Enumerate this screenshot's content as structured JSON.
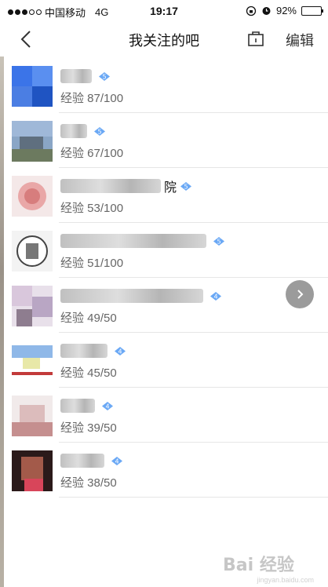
{
  "status_bar": {
    "carrier": "中国移动",
    "network": "4G",
    "time": "19:17",
    "battery": "92%",
    "battery_level": 0.92
  },
  "header": {
    "title": "我关注的吧",
    "edit_label": "编辑"
  },
  "bars": [
    {
      "name_suffix": "",
      "level": "5",
      "exp": "经验 87/100"
    },
    {
      "name_suffix": "",
      "level": "5",
      "exp": "经验 67/100"
    },
    {
      "name_suffix": "院",
      "level": "5",
      "exp": "经验 53/100"
    },
    {
      "name_suffix": "",
      "level": "5",
      "exp": "经验 51/100"
    },
    {
      "name_suffix": "",
      "level": "4",
      "exp": "经验 49/50"
    },
    {
      "name_suffix": "",
      "level": "4",
      "exp": "经验 45/50"
    },
    {
      "name_suffix": "",
      "level": "4",
      "exp": "经验 39/50"
    },
    {
      "name_suffix": "",
      "level": "4",
      "exp": "经验 38/50"
    }
  ],
  "watermark": {
    "main": "Bai 经验",
    "sub": "jingyan.baidu.com"
  },
  "icons": {
    "back": "chevron-left-icon",
    "bag": "bag-icon",
    "badge": "level-badge-icon",
    "float": "chevron-right-icon"
  },
  "colors": {
    "badge": "#6aa8f5",
    "separator": "#e6e6e6",
    "float_button": "#9b9b9b"
  }
}
